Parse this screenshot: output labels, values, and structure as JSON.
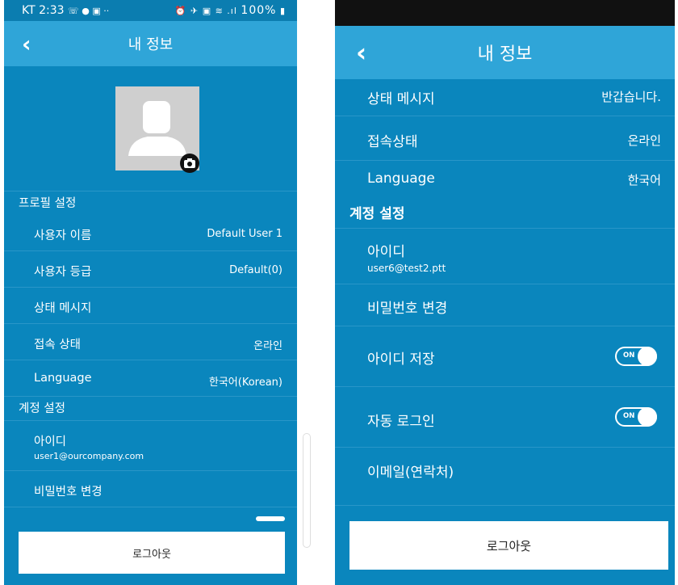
{
  "left": {
    "status_bar": {
      "time": "KT 2:33",
      "icons_left": "☏ ● ▣ ··",
      "icons_right": "⏰ ✈ ▣ ≋ .ıl",
      "battery": "100%"
    },
    "header": {
      "title": "내 정보",
      "back": "‹"
    },
    "profile_section": "프로필 설정",
    "rows": [
      {
        "label": "사용자 이름",
        "value": "Default User 1"
      },
      {
        "label": "사용자 등급",
        "value": "Default(0)"
      },
      {
        "label": "상태 메시지",
        "value": ""
      },
      {
        "label": "접속 상태",
        "value": "온라인"
      },
      {
        "label": "Language",
        "value": "한국어(Korean)"
      }
    ],
    "account_section": "계정 설정",
    "account_rows": [
      {
        "label": "아이디",
        "sub": "user1@ourcompany.com"
      },
      {
        "label": "비밀번호 변경"
      }
    ],
    "logout": "로그아웃"
  },
  "right": {
    "header": {
      "title": "내 정보",
      "back": "‹"
    },
    "rows": [
      {
        "label": "상태 메시지",
        "value": "반갑습니다."
      },
      {
        "label": "접속상태",
        "value": "온라인"
      },
      {
        "label": "Language",
        "value": "한국어"
      }
    ],
    "account_section": "계정 설정",
    "account_rows": [
      {
        "label": "아이디",
        "sub": "user6@test2.ptt"
      },
      {
        "label": "비밀번호 변경"
      },
      {
        "label": "아이디 저장",
        "toggle": "ON",
        "toggle_on": true
      },
      {
        "label": "자동 로그인",
        "toggle": "ON",
        "toggle_on": true
      },
      {
        "label": "이메일(연락처)"
      }
    ],
    "logout": "로그아웃"
  },
  "colors": {
    "primary": "#0a86bd",
    "header": "#2fa5d8",
    "divider": "#2996c8",
    "toggle_knob": "#ffffff"
  }
}
